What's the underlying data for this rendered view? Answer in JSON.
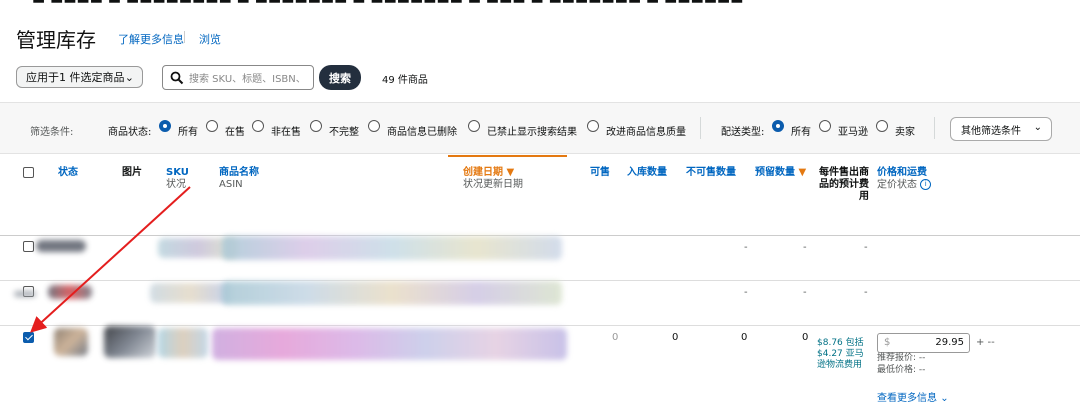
{
  "title": "管理库存",
  "learn_more": "了解更多信息",
  "browse": "浏览",
  "apply_selector": "应用于1 件选定商品",
  "search": {
    "placeholder": "搜索 SKU、标题、ISBN、",
    "button": "搜索"
  },
  "item_count": "49 件商品",
  "filters": {
    "label": "筛选条件:",
    "status_label": "商品状态:",
    "status_options": [
      "所有",
      "在售",
      "非在售",
      "不完整",
      "商品信息已删除",
      "已禁止显示搜索结果",
      "改进商品信息质量"
    ],
    "fulfillment_label": "配送类型:",
    "fulfillment_options": [
      "所有",
      "亚马逊",
      "卖家"
    ],
    "more": "其他筛选条件"
  },
  "columns": {
    "status": "状态",
    "image": "图片",
    "sku": "SKU",
    "sku_sub": "状况",
    "name": "商品名称",
    "name_sub": "ASIN",
    "date": "创建日期",
    "date_sub": "状况更新日期",
    "available": "可售",
    "inbound": "入库数量",
    "unfulfillable": "不可售数量",
    "reserved": "预留数量",
    "fee_l1": "每件售出商",
    "fee_l2": "品的预计费",
    "fee_l3": "用",
    "price": "价格和运费",
    "price_sub": "定价状态"
  },
  "rows": {
    "r1": {
      "c1": "-",
      "c2": "-",
      "c3": "-"
    },
    "r2": {
      "c1": "-",
      "c2": "-",
      "c3": "-"
    },
    "r3": {
      "available": "0",
      "inbound": "0",
      "unfulfillable": "0",
      "reserved": "0",
      "fee_l1": "$8.76 包括",
      "fee_l2": "$4.27 亚马",
      "fee_l3": "逊物流费用",
      "currency": "$",
      "price": "29.95",
      "plus": "+ --",
      "rec_price": "推荐报价: --",
      "min_price": "最低价格: --",
      "more": "查看更多信息"
    }
  },
  "colors": {
    "accent": "#0b5cad",
    "sort": "#e47911",
    "link": "#0066c0",
    "arrow": "#e41e1e"
  }
}
